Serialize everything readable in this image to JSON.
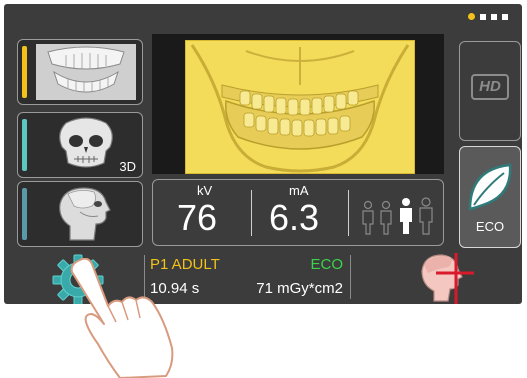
{
  "page_indicator": {
    "count": 4,
    "active_index": 0
  },
  "modes": [
    {
      "id": "pano",
      "accent": "#f2c21a",
      "icon": "jaw-xray-icon"
    },
    {
      "id": "3d",
      "accent": "#5cc6c0",
      "icon": "skull-3d-icon",
      "tag": "3D"
    },
    {
      "id": "ceph",
      "accent": "#5a9aa8",
      "icon": "head-profile-icon"
    }
  ],
  "params": {
    "kv_label": "kV",
    "kv_value": "76",
    "ma_label": "mA",
    "ma_value": "6.3",
    "patient_sizes_icon": "patient-size-icon",
    "selected_size": "medium"
  },
  "hd_label": "HD",
  "eco": {
    "label": "ECO",
    "icon": "leaf-icon",
    "active": true
  },
  "info": {
    "program": "P1 ADULT",
    "mode": "ECO",
    "time": "10.94 s",
    "dose": "71 mGy*cm2"
  },
  "colors": {
    "screen_bg": "#3c3c3c",
    "accent_yellow": "#f2c21a",
    "eco_green": "#3bd34a",
    "settings_teal": "#3aa9a9",
    "positioning_red": "#d91a2a"
  }
}
